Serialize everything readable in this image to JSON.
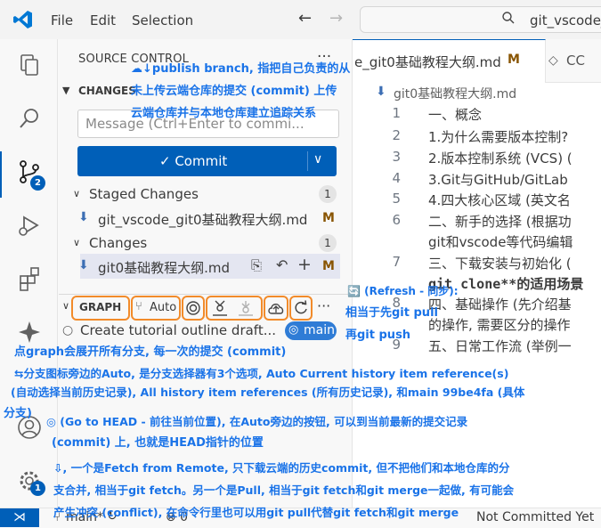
{
  "titlebar": {
    "menus": [
      "File",
      "Edit",
      "Selection"
    ],
    "command_center_text": "git_vscode_e"
  },
  "activity": {
    "scm_badge": "2",
    "account_badge": "1"
  },
  "sidebar": {
    "title": "SOURCE CONTROL",
    "more": "···",
    "changes_header": "CHANGES",
    "message_placeholder": "Message (Ctrl+Enter to commi...",
    "commit_label": "✓ Commit",
    "staged_header": "Staged Changes",
    "staged_count": "1",
    "staged_file": "git_vscode_git0基础教程大纲.md",
    "staged_status": "M",
    "changes_subheader": "Changes",
    "changes_count": "1",
    "changed_file": "git0基础教程大纲.md",
    "changed_status": "M"
  },
  "graph": {
    "label": "GRAPH",
    "auto_label": "Auto",
    "more": "···",
    "commit_message": "Create tutorial outline draft...",
    "branch_pill": "main"
  },
  "editor": {
    "tab1": "e_git0基础教程大纲.md",
    "tab1_status": "M",
    "tab2": "CC",
    "breadcrumb": "git0基础教程大纲.md",
    "lines": [
      {
        "n": "1",
        "text": "一、概念"
      },
      {
        "n": "2",
        "text": "1.为什么需要版本控制?"
      },
      {
        "n": "3",
        "text": "2.版本控制系统 (VCS) ("
      },
      {
        "n": "4",
        "text": "3.Git与GitHub/GitLab"
      },
      {
        "n": "5",
        "text": "4.四大核心区域 (英文名"
      },
      {
        "n": "6",
        "text": "二、新手的选择 (根据功"
      },
      {
        "n": "",
        "text": "git和vscode等代码编辑"
      },
      {
        "n": "7",
        "text": "三、下载安装与初始化 ("
      },
      {
        "n": "",
        "text": "git clone**的适用场景"
      },
      {
        "n": "8",
        "text": "四、基础操作 (先介绍基"
      },
      {
        "n": "",
        "text": "的操作, 需要区分的操作"
      },
      {
        "n": "9",
        "text": "五、日常工作流 (举例一"
      }
    ]
  },
  "status": {
    "branch": "main*",
    "sync": "↻",
    "errors": "⊗ 0",
    "not_committed": "Not Committed Yet"
  },
  "annotations": {
    "a1": "☁↓publish branch, 指把自己负责的从",
    "a2": "未上传云端仓库的提交 (commit) 上传",
    "a3": "云端仓库并与本地仓库建立追踪关系",
    "a4": "🔄 (Refresh - 同步):",
    "a5": "相当于先git pull",
    "a6": "再git push",
    "a7": "点graph会展开所有分支, 每一次的提交 (commit)",
    "a8": "⇆分支图标旁边的Auto, 是分支选择器有3个选项, Auto Current history item reference(s)",
    "a9": "(自动选择当前历史记录), All history item references (所有历史记录), 和main 99be4fa (具体",
    "a10": "分支)",
    "a11": "◎ (Go to HEAD - 前往当前位置), 在Auto旁边的按钮, 可以到当前最新的提交记录",
    "a12": "(commit) 上, 也就是HEAD指针的位置",
    "a13": "⇩, 一个是Fetch from Remote, 只下载云端的历史commit, 但不把他们和本地仓库的分",
    "a14": "支合并, 相当于git fetch。另一个是Pull, 相当于git fetch和git merge一起做, 有可能会",
    "a15": "产生冲突 (conflict), 在命令行里也可以用git pull代替git fetch和git merge"
  }
}
